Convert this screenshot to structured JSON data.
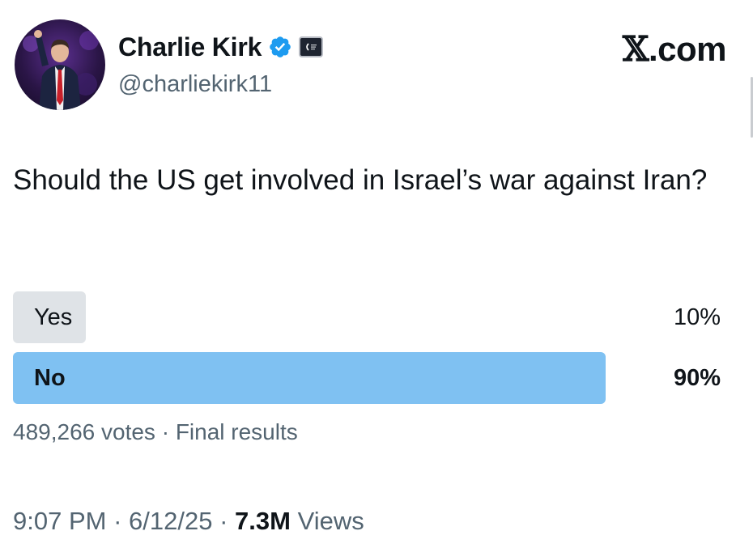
{
  "author": {
    "display_name": "Charlie Kirk",
    "handle": "@charliekirk11",
    "verified_icon": "verified-badge-icon",
    "affiliation_icon": "affiliation-badge-icon"
  },
  "site_mark": {
    "symbol": "𝕏",
    "text": ".com"
  },
  "tweet": {
    "text": "Should the US get involved in Israel’s war against Iran?"
  },
  "poll": {
    "options": [
      {
        "label": "Yes",
        "percent_text": "10%",
        "percent": 10,
        "winner": false
      },
      {
        "label": "No",
        "percent_text": "90%",
        "percent": 90,
        "winner": true
      }
    ],
    "votes": "489,266 votes",
    "status": "Final results",
    "separator": "·"
  },
  "meta": {
    "time": "9:07 PM",
    "date": "6/12/25",
    "views_count": "7.3M",
    "views_label": "Views",
    "separator": "·"
  },
  "colors": {
    "winner_bar": "#7fc1f2",
    "loser_bar": "#dfe3e7",
    "secondary_text": "#536471",
    "verified": "#1d9bf0"
  }
}
